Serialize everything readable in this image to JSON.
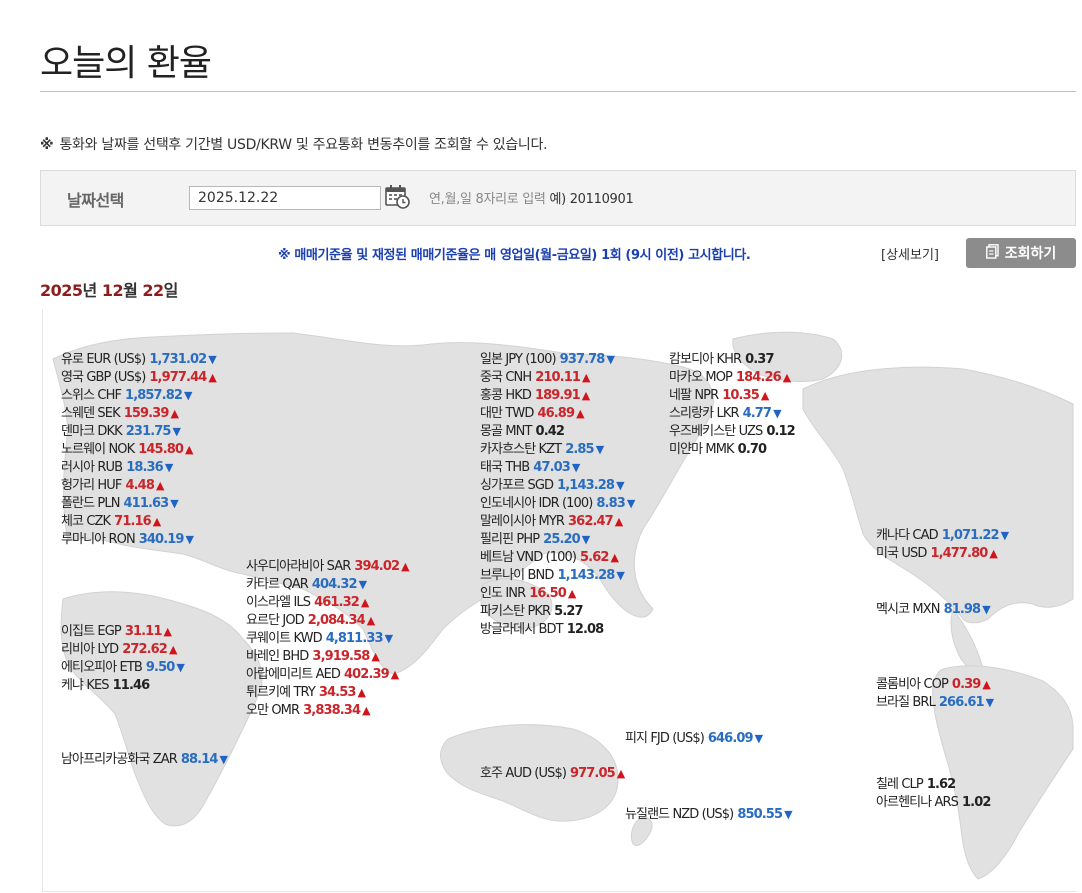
{
  "page": {
    "title": "오늘의 환율"
  },
  "notice": {
    "mark": "※",
    "text": "통화와 날짜를 선택후 기간별 USD/KRW 및 주요통화 변동추이를 조회할 수 있습니다."
  },
  "date_select": {
    "label": "날짜선택",
    "value": "2025.12.22",
    "hint": "연,월,일 8자리로 입력",
    "example": "예) 20110901",
    "calendar_icon": "calendar-icon"
  },
  "announcement": {
    "text": "※ 매매기준율 및 재정된 매매기준율은 매 영업일(월-금요일) 1회 (9시 이전) 고시합니다.",
    "detail_link": "[상세보기]",
    "query_button": "조회하기",
    "query_icon": "document-icon"
  },
  "date_heading": {
    "year": "2025",
    "year_unit": "년 ",
    "month": "12",
    "month_unit": "월 ",
    "day": "22",
    "day_unit": "일"
  },
  "colors": {
    "up": "#d0141c",
    "down": "#1f64c4",
    "map_land": "#e1e1e1",
    "date_number": "#8b1d1d",
    "announcement": "#1a3fb0"
  },
  "regions": {
    "europe": [
      {
        "name": "유로 EUR (US$)",
        "value": "1,731.02",
        "dir": "down"
      },
      {
        "name": "영국 GBP (US$)",
        "value": "1,977.44",
        "dir": "up"
      },
      {
        "name": "스위스 CHF",
        "value": "1,857.82",
        "dir": "down"
      },
      {
        "name": "스웨덴 SEK",
        "value": "159.39",
        "dir": "up"
      },
      {
        "name": "덴마크 DKK",
        "value": "231.75",
        "dir": "down"
      },
      {
        "name": "노르웨이 NOK",
        "value": "145.80",
        "dir": "up"
      },
      {
        "name": "러시아 RUB",
        "value": "18.36",
        "dir": "down"
      },
      {
        "name": "헝가리 HUF",
        "value": "4.48",
        "dir": "up"
      },
      {
        "name": "폴란드 PLN",
        "value": "411.63",
        "dir": "down"
      },
      {
        "name": "체코 CZK",
        "value": "71.16",
        "dir": "up"
      },
      {
        "name": "루마니아 RON",
        "value": "340.19",
        "dir": "down"
      }
    ],
    "africa": [
      {
        "name": "이집트 EGP",
        "value": "31.11",
        "dir": "up"
      },
      {
        "name": "리비아 LYD",
        "value": "272.62",
        "dir": "up"
      },
      {
        "name": "에티오피아 ETB",
        "value": "9.50",
        "dir": "down"
      },
      {
        "name": "케냐 KES",
        "value": "11.46",
        "dir": "flat"
      }
    ],
    "south_africa": [
      {
        "name": "남아프리카공화국 ZAR",
        "value": "88.14",
        "dir": "down"
      }
    ],
    "middle_east": [
      {
        "name": "사우디아라비아 SAR",
        "value": "394.02",
        "dir": "up"
      },
      {
        "name": "카타르 QAR",
        "value": "404.32",
        "dir": "down"
      },
      {
        "name": "이스라엘 ILS",
        "value": "461.32",
        "dir": "up"
      },
      {
        "name": "요르단 JOD",
        "value": "2,084.34",
        "dir": "up"
      },
      {
        "name": "쿠웨이트 KWD",
        "value": "4,811.33",
        "dir": "down"
      },
      {
        "name": "바레인 BHD",
        "value": "3,919.58",
        "dir": "up"
      },
      {
        "name": "아랍에미리트 AED",
        "value": "402.39",
        "dir": "up"
      },
      {
        "name": "튀르키예 TRY",
        "value": "34.53",
        "dir": "up"
      },
      {
        "name": "오만 OMR",
        "value": "3,838.34",
        "dir": "up"
      }
    ],
    "asia": [
      {
        "name": "일본 JPY (100)",
        "value": "937.78",
        "dir": "down"
      },
      {
        "name": "중국 CNH",
        "value": "210.11",
        "dir": "up"
      },
      {
        "name": "홍콩 HKD",
        "value": "189.91",
        "dir": "up"
      },
      {
        "name": "대만 TWD",
        "value": "46.89",
        "dir": "up"
      },
      {
        "name": "몽골 MNT",
        "value": "0.42",
        "dir": "flat"
      },
      {
        "name": "카자흐스탄 KZT",
        "value": "2.85",
        "dir": "down"
      },
      {
        "name": "태국 THB",
        "value": "47.03",
        "dir": "down"
      },
      {
        "name": "싱가포르 SGD",
        "value": "1,143.28",
        "dir": "down"
      },
      {
        "name": "인도네시아 IDR (100)",
        "value": "8.83",
        "dir": "down"
      },
      {
        "name": "말레이시아 MYR",
        "value": "362.47",
        "dir": "up"
      },
      {
        "name": "필리핀 PHP",
        "value": "25.20",
        "dir": "down"
      },
      {
        "name": "베트남 VND (100)",
        "value": "5.62",
        "dir": "up"
      },
      {
        "name": "브루나이 BND",
        "value": "1,143.28",
        "dir": "down"
      },
      {
        "name": "인도 INR",
        "value": "16.50",
        "dir": "up"
      },
      {
        "name": "파키스탄 PKR",
        "value": "5.27",
        "dir": "flat"
      },
      {
        "name": "방글라데시 BDT",
        "value": "12.08",
        "dir": "flat"
      }
    ],
    "asia2": [
      {
        "name": "캄보디아 KHR",
        "value": "0.37",
        "dir": "flat"
      },
      {
        "name": "마카오 MOP",
        "value": "184.26",
        "dir": "up"
      },
      {
        "name": "네팔 NPR",
        "value": "10.35",
        "dir": "up"
      },
      {
        "name": "스리랑카 LKR",
        "value": "4.77",
        "dir": "down"
      },
      {
        "name": "우즈베키스탄 UZS",
        "value": "0.12",
        "dir": "flat"
      },
      {
        "name": "미얀마 MMK",
        "value": "0.70",
        "dir": "flat"
      }
    ],
    "north_america": [
      {
        "name": "캐나다 CAD",
        "value": "1,071.22",
        "dir": "down"
      },
      {
        "name": "미국 USD",
        "value": "1,477.80",
        "dir": "up"
      }
    ],
    "mexico": [
      {
        "name": "멕시코 MXN",
        "value": "81.98",
        "dir": "down"
      }
    ],
    "south_america": [
      {
        "name": "콜롬비아 COP",
        "value": "0.39",
        "dir": "up"
      },
      {
        "name": "브라질 BRL",
        "value": "266.61",
        "dir": "down"
      }
    ],
    "south_america2": [
      {
        "name": "칠레 CLP",
        "value": "1.62",
        "dir": "flat"
      },
      {
        "name": "아르헨티나 ARS",
        "value": "1.02",
        "dir": "flat"
      }
    ],
    "fiji": [
      {
        "name": "피지 FJD (US$)",
        "value": "646.09",
        "dir": "down"
      }
    ],
    "australia": [
      {
        "name": "호주 AUD (US$)",
        "value": "977.05",
        "dir": "up"
      }
    ],
    "new_zealand": [
      {
        "name": "뉴질랜드 NZD (US$)",
        "value": "850.55",
        "dir": "down"
      }
    ]
  }
}
